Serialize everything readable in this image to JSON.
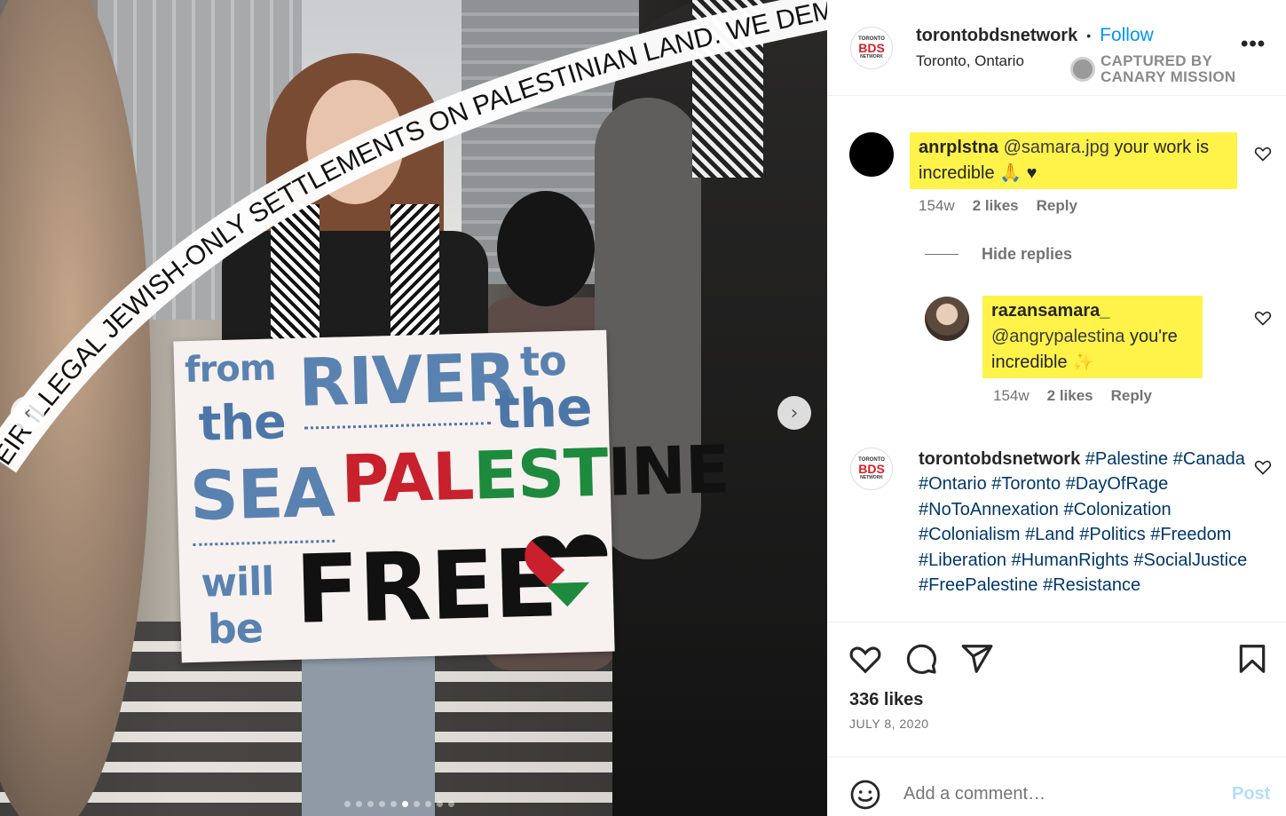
{
  "photo": {
    "arc_text": "EIR ILLEGAL JEWISH-ONLY SETTLEMENTS ON PALESTINIAN LAND. WE DEMAND",
    "sign": {
      "from": "from",
      "river": "RIVER",
      "to": "to",
      "the1": "the",
      "the2": "the",
      "sea": "SEA",
      "pal_red": "PAL",
      "pal_green": "EST",
      "pal_black": "INE",
      "will": "will",
      "be": "be",
      "free": "FREE"
    },
    "carousel": {
      "total": 10,
      "active_index": 5
    }
  },
  "header": {
    "avatar": {
      "top": "TORONTO",
      "mid": "BDS",
      "bottom": "NETWORK"
    },
    "username": "torontobdsnetwork",
    "separator": "•",
    "follow_label": "Follow",
    "location": "Toronto, Ontario",
    "more_label": "•••",
    "watermark": {
      "line1": "CAPTURED BY",
      "line2": "CANARY MISSION"
    }
  },
  "comments": [
    {
      "username": "anrplstna",
      "mention": "@samara.jpg",
      "text": " your work is incredible 🙏 ♥",
      "age": "154w",
      "likes": "2 likes",
      "reply": "Reply"
    }
  ],
  "hide_replies": "Hide replies",
  "replies": [
    {
      "username": "razansamara_",
      "mention": "@angrypalestina",
      "text": " you're incredible ✨",
      "age": "154w",
      "likes": "2 likes",
      "reply": "Reply"
    }
  ],
  "caption": {
    "username": "torontobdsnetwork",
    "tags": [
      "#Palestine",
      "#Canada",
      "#Ontario",
      "#Toronto",
      "#DayOfRage",
      "#NoToAnnexation",
      "#Colonization",
      "#Colonialism",
      "#Land",
      "#Politics",
      "#Freedom",
      "#Liberation",
      "#HumanRights",
      "#SocialJustice",
      "#FreePalestine",
      "#Resistance"
    ]
  },
  "footer": {
    "likes": "336 likes",
    "date": "JULY 8, 2020",
    "add_comment_placeholder": "Add a comment…",
    "post_label": "Post"
  },
  "colors": {
    "link_blue": "#0095f6",
    "highlight": "#fff34a",
    "hashtag": "#00376b",
    "bds_red": "#d6202b"
  },
  "icons": [
    "chevron-left-icon",
    "chevron-right-icon",
    "more-icon",
    "heart-icon",
    "comment-icon",
    "share-icon",
    "bookmark-icon",
    "emoji-icon"
  ]
}
